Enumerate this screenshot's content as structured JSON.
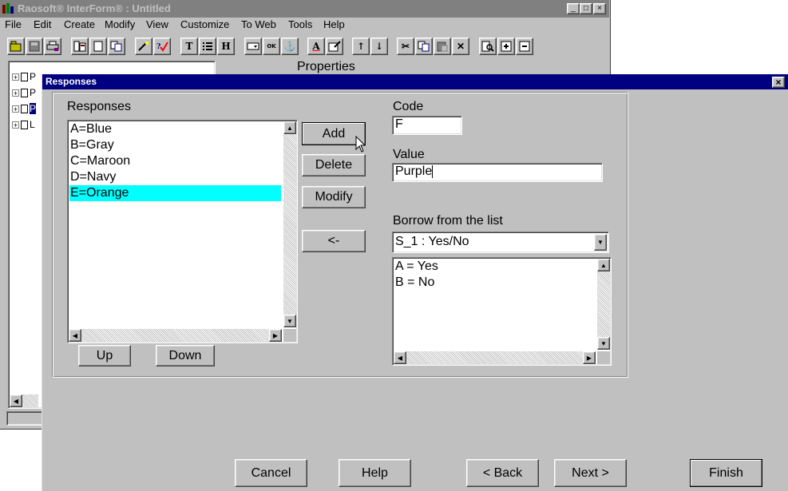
{
  "app": {
    "title": "Raosoft® InterForm® : Untitled",
    "window_buttons": [
      "_",
      "□",
      "×"
    ],
    "menu": [
      "File",
      "Edit",
      "Create",
      "Modify",
      "View",
      "Customize",
      "To Web",
      "Tools",
      "Help"
    ],
    "properties_label": "Properties",
    "tree_items": [
      "P",
      "P",
      "P",
      "L"
    ]
  },
  "toolbar_glyphs": {
    "text": "T",
    "heading": "H",
    "ok": "OK",
    "anchor": "⚓",
    "font": "A",
    "up": "↑",
    "down": "↓",
    "cut": "✂",
    "delete": "✕"
  },
  "dialog": {
    "title": "Responses",
    "close": "×",
    "responses_label": "Responses",
    "responses": [
      "A=Blue",
      "B=Gray",
      "C=Maroon",
      "D=Navy",
      "E=Orange"
    ],
    "selected_index": 4,
    "add_label": "Add",
    "delete_label": "Delete",
    "modify_label": "Modify",
    "move_left_label": "<-",
    "up_label": "Up",
    "down_label": "Down",
    "code_label": "Code",
    "code_value": "F",
    "value_label": "Value",
    "value_value": "Purple",
    "borrow_label": "Borrow from the list",
    "borrow_selected": "S_1 : Yes/No",
    "borrow_items": [
      "A = Yes",
      "B = No"
    ],
    "cancel_label": "Cancel",
    "help_label": "Help",
    "back_label": "< Back",
    "next_label": "Next >",
    "finish_label": "Finish"
  },
  "colors": {
    "selection": "#00ffff",
    "title_active": "#000080",
    "title_inactive": "#808080",
    "face": "#c0c0c0"
  }
}
